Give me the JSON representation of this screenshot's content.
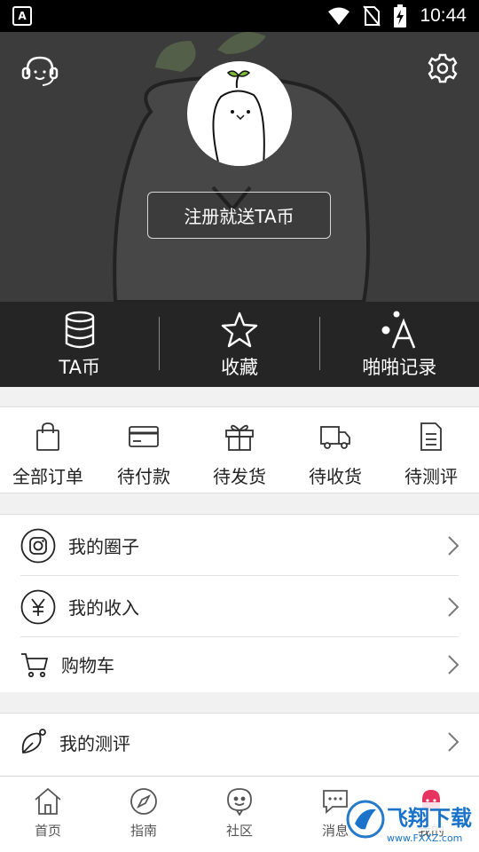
{
  "status_bar": {
    "time": "10:44",
    "left_badge": "A"
  },
  "header": {
    "register_label": "注册就送TA币"
  },
  "stats": [
    {
      "label": "TA币",
      "icon": "coins-icon"
    },
    {
      "label": "收藏",
      "icon": "star-icon"
    },
    {
      "label": "啪啪记录",
      "icon": "dots-a-icon"
    }
  ],
  "orders": [
    {
      "label": "全部订单",
      "icon": "shopping-bag-icon"
    },
    {
      "label": "待付款",
      "icon": "credit-card-icon"
    },
    {
      "label": "待发货",
      "icon": "gift-icon"
    },
    {
      "label": "待收货",
      "icon": "truck-icon"
    },
    {
      "label": "待测评",
      "icon": "document-icon"
    }
  ],
  "menu": {
    "circle": "我的圈子",
    "income": "我的收入",
    "cart": "购物车",
    "review": "我的测评"
  },
  "tabs": [
    {
      "label": "首页",
      "icon": "home-icon"
    },
    {
      "label": "指南",
      "icon": "compass-icon"
    },
    {
      "label": "社区",
      "icon": "community-icon"
    },
    {
      "label": "消息",
      "icon": "message-icon"
    },
    {
      "label": "我的",
      "icon": "profile-icon"
    }
  ],
  "watermark": {
    "brand": "飞翔下载",
    "url": "www.FXXZ.com"
  },
  "colors": {
    "header_bg": "#3c3c3c",
    "stats_bg": "#252525",
    "watermark_blue": "#1a73c8"
  }
}
